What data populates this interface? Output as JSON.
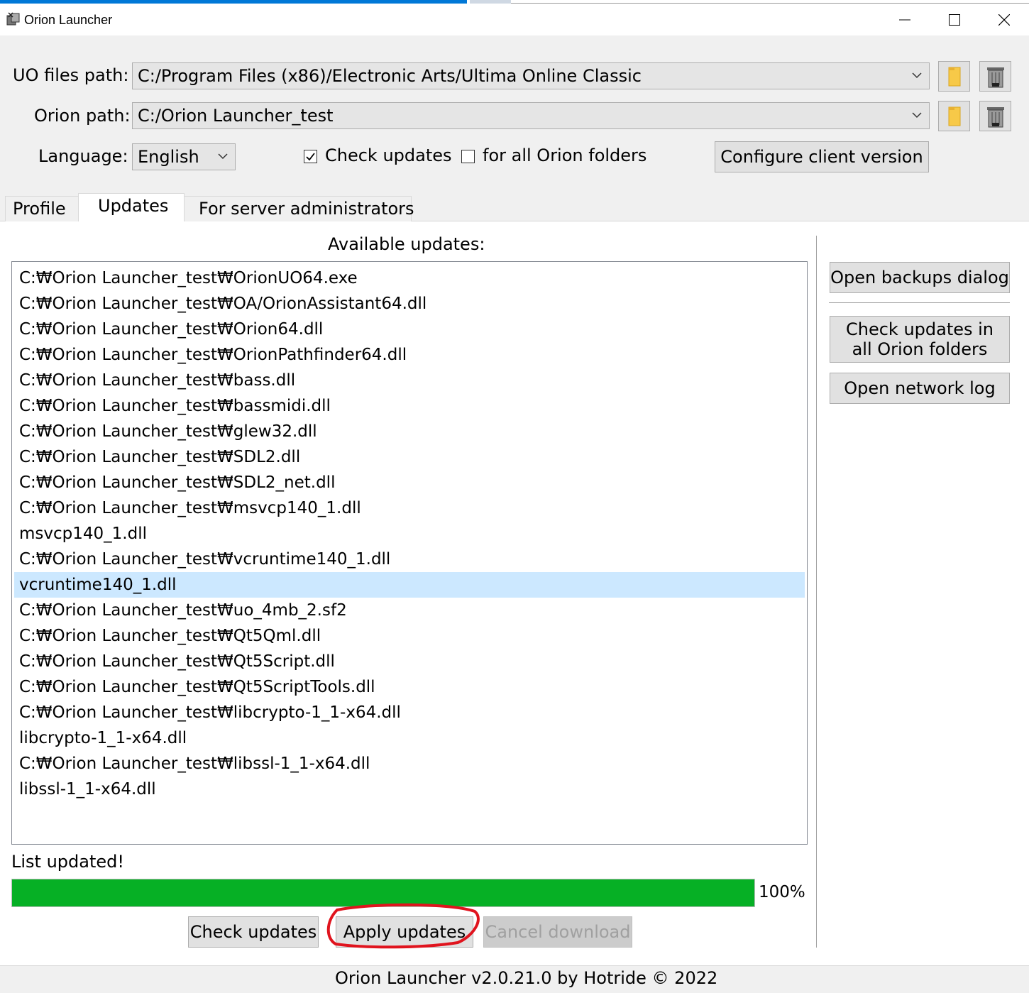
{
  "window": {
    "title": "Orion Launcher"
  },
  "settings": {
    "uo_path_label": "UO files path:",
    "uo_path_value": "C:/Program Files (x86)/Electronic Arts/Ultima Online Classic",
    "orion_path_label": "Orion path:",
    "orion_path_value": "C:/Orion Launcher_test",
    "language_label": "Language:",
    "language_value": "English",
    "check_updates_label": "Check updates",
    "check_updates_checked": true,
    "all_folders_label": "for all Orion folders",
    "all_folders_checked": false,
    "configure_button": "Configure client version"
  },
  "tabs": [
    {
      "label": "Profile",
      "active": false
    },
    {
      "label": "Updates",
      "active": true
    },
    {
      "label": "For server administrators",
      "active": false
    }
  ],
  "updates": {
    "heading": "Available updates:",
    "items": [
      "C:₩Orion Launcher_test₩OrionUO64.exe",
      "C:₩Orion Launcher_test₩OA/OrionAssistant64.dll",
      "C:₩Orion Launcher_test₩Orion64.dll",
      "C:₩Orion Launcher_test₩OrionPathfinder64.dll",
      "C:₩Orion Launcher_test₩bass.dll",
      "C:₩Orion Launcher_test₩bassmidi.dll",
      "C:₩Orion Launcher_test₩glew32.dll",
      "C:₩Orion Launcher_test₩SDL2.dll",
      "C:₩Orion Launcher_test₩SDL2_net.dll",
      "C:₩Orion Launcher_test₩msvcp140_1.dll",
      "msvcp140_1.dll",
      "C:₩Orion Launcher_test₩vcruntime140_1.dll",
      "vcruntime140_1.dll",
      "C:₩Orion Launcher_test₩uo_4mb_2.sf2",
      "C:₩Orion Launcher_test₩Qt5Qml.dll",
      "C:₩Orion Launcher_test₩Qt5Script.dll",
      "C:₩Orion Launcher_test₩Qt5ScriptTools.dll",
      "C:₩Orion Launcher_test₩libcrypto-1_1-x64.dll",
      "libcrypto-1_1-x64.dll",
      "C:₩Orion Launcher_test₩libssl-1_1-x64.dll",
      "libssl-1_1-x64.dll"
    ],
    "selected_index": 12,
    "status_text": "List updated!",
    "progress_percent": 100,
    "progress_label": "100%",
    "check_button": "Check updates",
    "apply_button": "Apply updates",
    "cancel_button": "Cancel download"
  },
  "side_buttons": {
    "open_backups": "Open backups dialog",
    "check_all_line1": "Check updates in",
    "check_all_line2": "all Orion folders",
    "open_network_log": "Open network log"
  },
  "footer": {
    "text": "Orion Launcher v2.0.21.0 by Hotride © 2022"
  },
  "colors": {
    "progress_fill": "#06b025",
    "selection": "#cce8ff",
    "annotation_circle": "#e0141e"
  }
}
